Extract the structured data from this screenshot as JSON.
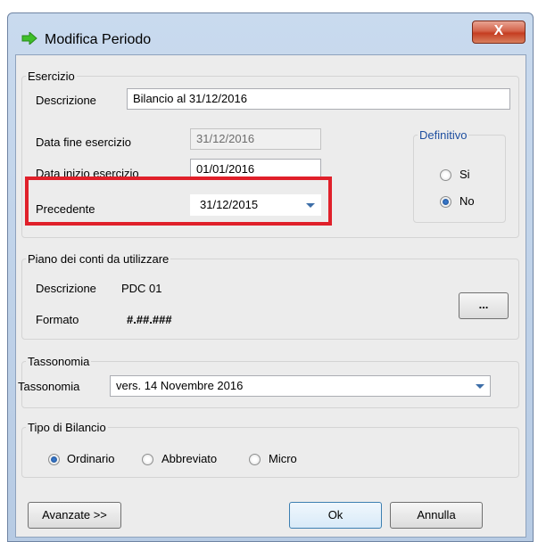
{
  "window": {
    "title": "Modifica Periodo",
    "close_glyph": "X"
  },
  "esercizio": {
    "legend": "Esercizio",
    "descrizione_label": "Descrizione",
    "descrizione_value": "Bilancio al 31/12/2016",
    "data_fine_label": "Data fine esercizio",
    "data_fine_value": "31/12/2016",
    "data_inizio_label": "Data inizio esercizio",
    "data_inizio_value": "01/01/2016",
    "precedente_label": "Precedente",
    "precedente_value": "31/12/2015",
    "definitivo": {
      "legend": "Definitivo",
      "options": [
        "Si",
        "No"
      ],
      "selected": "No"
    }
  },
  "piano": {
    "legend": "Piano dei conti da utilizzare",
    "descrizione_label": "Descrizione",
    "descrizione_value": "PDC 01",
    "formato_label": "Formato",
    "formato_value": "#.##.###",
    "browse_label": "..."
  },
  "tassonomia": {
    "legend": "Tassonomia",
    "label": "Tassonomia",
    "value": "vers. 14 Novembre 2016"
  },
  "tipo": {
    "legend": "Tipo di Bilancio",
    "options": [
      "Ordinario",
      "Abbreviato",
      "Micro"
    ],
    "selected": "Ordinario"
  },
  "buttons": {
    "avanzate": "Avanzate >>",
    "ok": "Ok",
    "annulla": "Annulla"
  },
  "colors": {
    "highlight": "#e0202a",
    "title_icon": "#3fbf2a",
    "accent": "#3d6ea8"
  }
}
